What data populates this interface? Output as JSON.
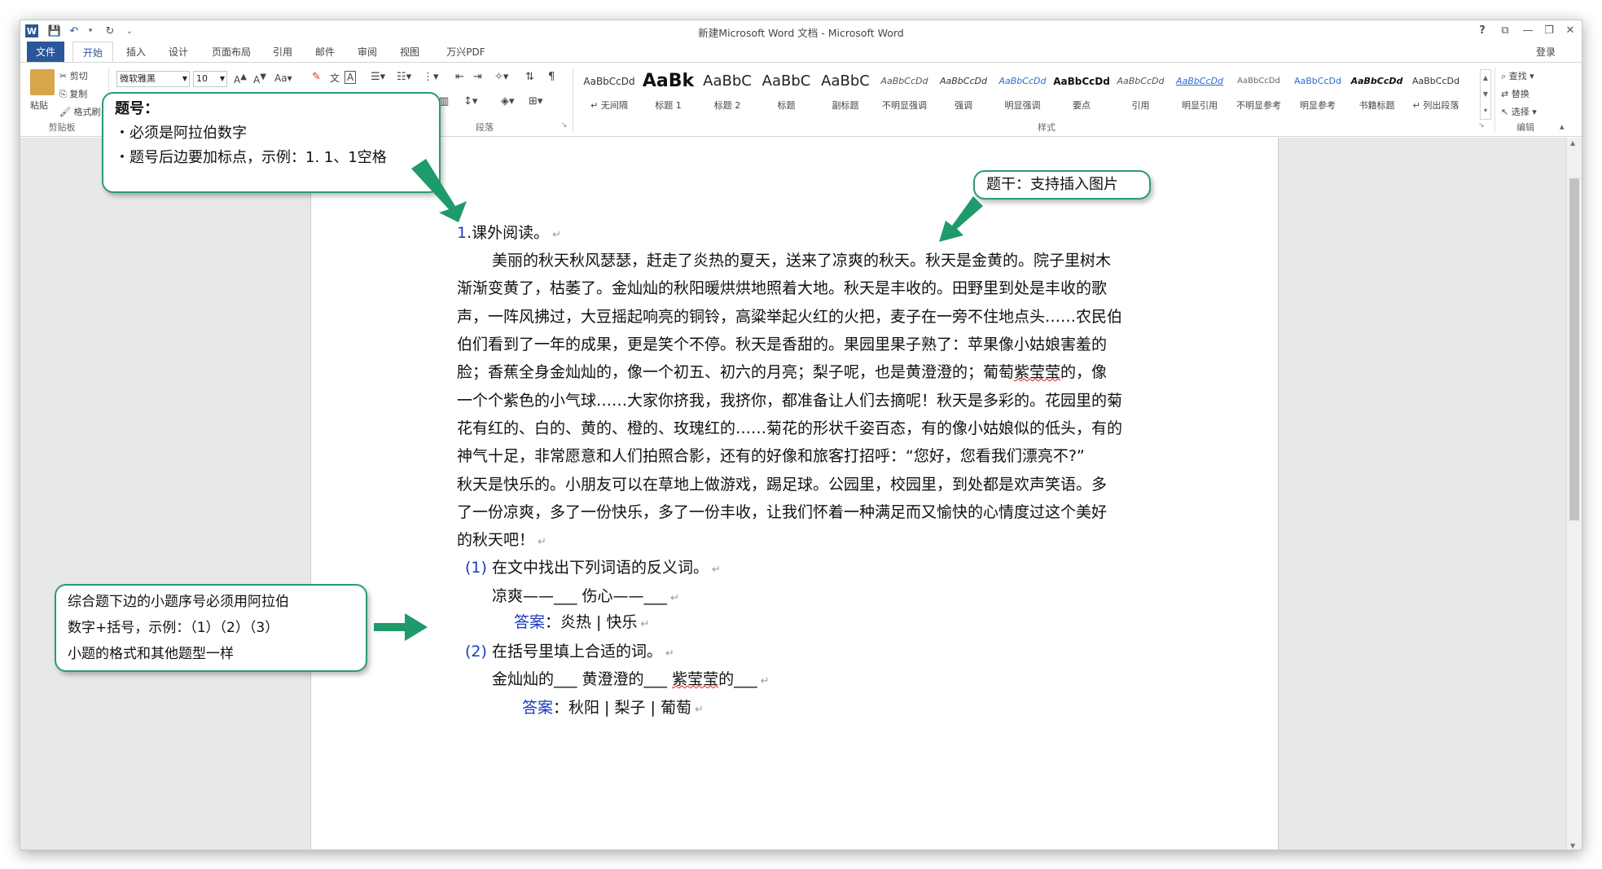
{
  "window": {
    "title": "新建Microsoft Word 文档 - Microsoft Word",
    "help": "?",
    "login": "登录"
  },
  "qat": {
    "word_icon": "W",
    "save_icon": "💾",
    "undo_icon": "↶",
    "redo_icon": "↻",
    "customize_icon": "⌄"
  },
  "window_controls": {
    "ribbon_display": "⧉",
    "minimize": "—",
    "restore": "❐",
    "close": "✕"
  },
  "tabs": [
    "文件",
    "开始",
    "插入",
    "设计",
    "页面布局",
    "引用",
    "邮件",
    "审阅",
    "视图",
    "万兴PDF"
  ],
  "ribbon": {
    "clipboard": {
      "paste": "粘贴",
      "cut": "剪切",
      "copy": "复制",
      "format_painter": "格式刷",
      "label": "剪贴板"
    },
    "font": {
      "name": "微软雅黑",
      "size": "10"
    },
    "paragraph": {
      "label": "段落"
    },
    "styles": {
      "label": "样式",
      "items": [
        {
          "preview": "AaBbCcDd",
          "name": "↵ 无间隔"
        },
        {
          "preview": "AaBk",
          "name": "标题 1"
        },
        {
          "preview": "AaBbC",
          "name": "标题 2"
        },
        {
          "preview": "AaBbC",
          "name": "标题"
        },
        {
          "preview": "AaBbC",
          "name": "副标题"
        },
        {
          "preview": "AaBbCcDd",
          "name": "不明显强调"
        },
        {
          "preview": "AaBbCcDd",
          "name": "强调"
        },
        {
          "preview": "AaBbCcDd",
          "name": "明显强调"
        },
        {
          "preview": "AaBbCcDd",
          "name": "要点"
        },
        {
          "preview": "AaBbCcDd",
          "name": "引用"
        },
        {
          "preview": "AaBbCcDd",
          "name": "明显引用"
        },
        {
          "preview": "AaBbCcDd",
          "name": "不明显参考"
        },
        {
          "preview": "AaBbCcDd",
          "name": "明显参考"
        },
        {
          "preview": "AaBbCcDd",
          "name": "书籍标题"
        },
        {
          "preview": "AaBbCcDd",
          "name": "↵ 列出段落"
        }
      ]
    },
    "editing": {
      "find": "查找",
      "replace": "替换",
      "select": "选择",
      "label": "编辑"
    }
  },
  "callouts": {
    "number": {
      "title": "题号：",
      "line1": "・必须是阿拉伯数字",
      "line2": "・题号后边要加标点，示例：1. 1、1空格"
    },
    "stem": {
      "text": "题干：支持插入图片"
    },
    "sub": {
      "line1": "综合题下边的小题序号必须用阿拉伯",
      "line2": "数字+括号，示例：（1）（2）（3）",
      "line3": "小题的格式和其他题型一样"
    }
  },
  "doc": {
    "q_num": "1",
    "q_title": ".课外阅读。",
    "para": [
      "美丽的秋天秋风瑟瑟，赶走了炎热的夏天，送来了凉爽的秋天。秋天是金黄的。院子里树木",
      "渐渐变黄了，枯萎了。金灿灿的秋阳暖烘烘地照着大地。秋天是丰收的。田野里到处是丰收的歌",
      "声，一阵风拂过，大豆摇起响亮的铜铃，高粱举起火红的火把，麦子在一旁不住地点头……农民伯",
      "伯们看到了一年的成果，更是笑个不停。秋天是香甜的。果园里果子熟了：苹果像小姑娘害羞的",
      "一个个紫色的小气球……大家你挤我，我挤你，都准备让人们去摘呢！秋天是多彩的。花园里的菊",
      "花有红的、白的、黄的、橙的、玫瑰红的……菊花的形状千姿百态，有的像小姑娘似的低头，有的",
      "神气十足，非常愿意和人们拍照合影，还有的好像和旅客打招呼：“您好，您看我们漂亮不?”",
      "秋天是快乐的。小朋友可以在草地上做游戏，踢足球。公园里，校园里，到处都是欢声笑语。多",
      "了一份凉爽，多了一份快乐，多了一份丰收，让我们怀着一种满足而又愉快的心情度过这个美好",
      "的秋天吧！"
    ],
    "line5": {
      "a": "脸；香蕉全身金灿灿的，像一个初五、初六的月亮；梨子呢，也是黄澄澄的；葡萄",
      "b": "紫莹莹",
      "c": "的，像"
    },
    "sub1": {
      "num": "(1)",
      "text": "在文中找出下列词语的反义词。",
      "blanks": "凉爽——___ 伤心——___",
      "ans_label": "答案",
      "ans": "：炎热 | 快乐"
    },
    "sub2": {
      "num": "(2)",
      "text": "在括号里填上合适的词。",
      "blanks_a": "金灿灿的___ 黄澄澄的___ ",
      "blanks_b": "紫莹莹",
      "blanks_c": "的___",
      "ans_label": "答案",
      "ans": "：秋阳 | 梨子 | 葡萄"
    }
  },
  "colors": {
    "accent": "#2b579a",
    "callout_border": "#2a9a7a",
    "arrow": "#1f9a6a",
    "qnum": "#1a3ac4"
  }
}
